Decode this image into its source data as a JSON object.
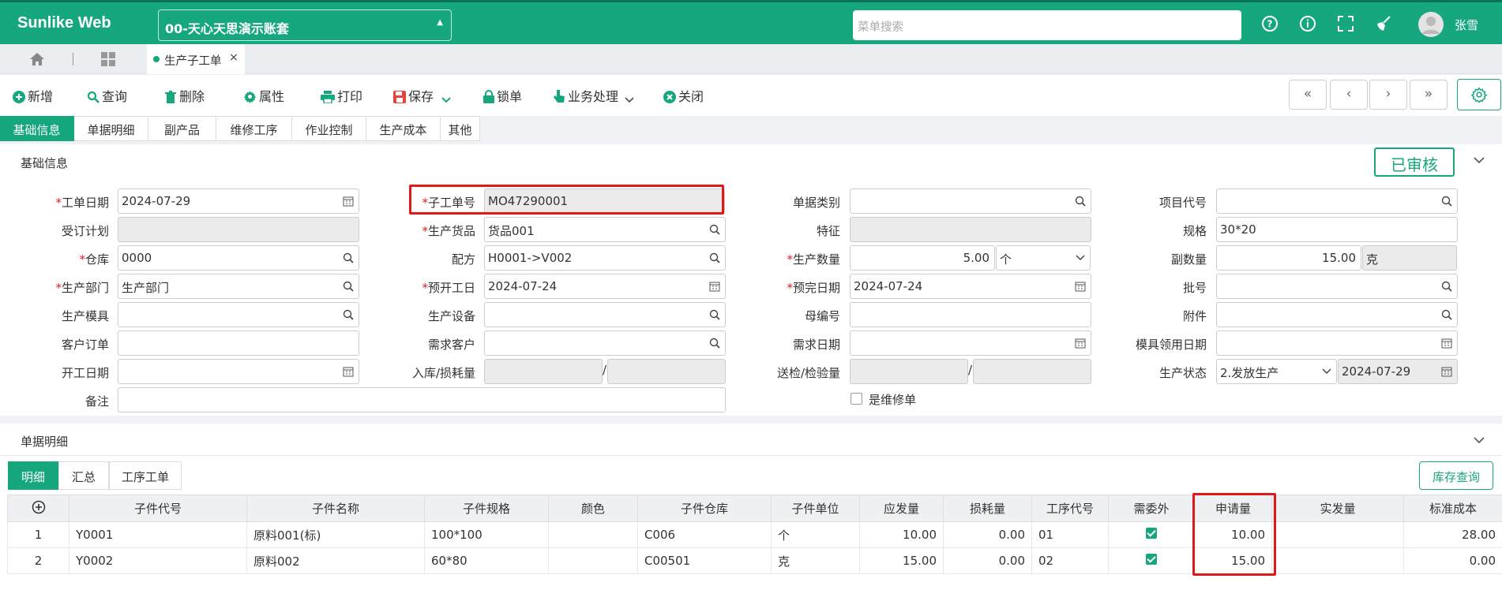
{
  "header": {
    "brand": "Sunlike Web",
    "account": "00-天心天思演示账套",
    "search_placeholder": "菜单搜索",
    "username": "张雪"
  },
  "tabs": {
    "doc_tab": "生产子工单"
  },
  "toolbar": {
    "new": "新增",
    "query": "查询",
    "delete": "删除",
    "attributes": "属性",
    "print": "打印",
    "save": "保存",
    "lock": "锁单",
    "business": "业务处理",
    "close": "关闭"
  },
  "section_tabs": [
    "基础信息",
    "单据明细",
    "副产品",
    "维修工序",
    "作业控制",
    "生产成本",
    "其他"
  ],
  "basic": {
    "title": "基础信息",
    "status": "已审核",
    "fields": {
      "order_date_label": "工单日期",
      "order_date": "2024-07-29",
      "sub_no_label": "子工单号",
      "sub_no": "MO47290001",
      "doc_type_label": "单据类别",
      "doc_type": "",
      "project_label": "项目代号",
      "project": "",
      "plan_label": "受订计划",
      "plan": "",
      "goods_label": "生产货品",
      "goods": "货品001",
      "feature_label": "特征",
      "feature": "",
      "spec_label": "规格",
      "spec": "30*20",
      "warehouse_label": "仓库",
      "warehouse": "0000",
      "formula_label": "配方",
      "formula": "H0001->V002",
      "qty_label": "生产数量",
      "qty": "5.00",
      "qty_unit": "个",
      "sub_qty_label": "副数量",
      "sub_qty": "15.00",
      "sub_unit": "克",
      "dept_label": "生产部门",
      "dept": "生产部门",
      "start_date_label": "预开工日",
      "start_date": "2024-07-24",
      "end_date_label": "预完日期",
      "end_date": "2024-07-24",
      "batch_label": "批号",
      "batch": "",
      "mold_label": "生产模具",
      "mold": "",
      "equipment_label": "生产设备",
      "equipment": "",
      "parent_no_label": "母编号",
      "parent_no": "",
      "attach_label": "附件",
      "attach": "",
      "customer_order_label": "客户订单",
      "customer_order": "",
      "demand_customer_label": "需求客户",
      "demand_customer": "",
      "demand_date_label": "需求日期",
      "demand_date": "",
      "mold_date_label": "模具领用日期",
      "mold_date": "",
      "work_date_label": "开工日期",
      "work_date": "",
      "stock_loss_label": "入库/损耗量",
      "stock_qty": "",
      "loss_qty": "",
      "inspect_label": "送检/检验量",
      "inspect_send": "",
      "inspect_done": "",
      "prod_status_label": "生产状态",
      "prod_status": "2.发放生产",
      "prod_status_date": "2024-07-29",
      "remark_label": "备注",
      "remark": "",
      "repair_label": "是维修单",
      "slash": "/"
    }
  },
  "detail": {
    "title": "单据明细",
    "subtabs": [
      "明细",
      "汇总",
      "工序工单"
    ],
    "stock_button": "库存查询",
    "columns": [
      "子件代号",
      "子件名称",
      "子件规格",
      "颜色",
      "子件仓库",
      "子件单位",
      "应发量",
      "损耗量",
      "工序代号",
      "需委外",
      "申请量",
      "实发量",
      "标准成本"
    ],
    "rows": [
      {
        "no": "1",
        "code": "Y0001",
        "name": "原料001(标)",
        "spec": "100*100",
        "color": "",
        "wh": "C006",
        "unit": "个",
        "should": "10.00",
        "loss": "0.00",
        "proc": "01",
        "outsource": true,
        "apply": "10.00",
        "actual": "",
        "cost": "28.00"
      },
      {
        "no": "2",
        "code": "Y0002",
        "name": "原料002",
        "spec": "60*80",
        "color": "",
        "wh": "C00501",
        "unit": "克",
        "should": "15.00",
        "loss": "0.00",
        "proc": "02",
        "outsource": true,
        "apply": "15.00",
        "actual": "",
        "cost": "0.00"
      }
    ]
  },
  "colors": {
    "accent": "#17a77f",
    "highlight": "#e01818"
  }
}
